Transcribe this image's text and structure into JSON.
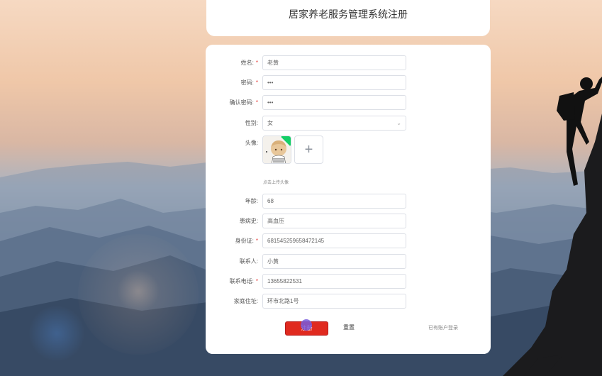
{
  "header": {
    "title": "居家养老服务管理系统注册"
  },
  "form": {
    "fields": [
      {
        "label": "姓名:",
        "required": true,
        "value": "老黄"
      },
      {
        "label": "密码:",
        "required": true,
        "value": "•••"
      },
      {
        "label": "确认密码:",
        "required": true,
        "value": "•••"
      },
      {
        "label": "性别:",
        "required": false,
        "value": "女"
      },
      {
        "label": "头像:",
        "required": false,
        "value": ""
      },
      {
        "label": "年龄:",
        "required": false,
        "value": "68"
      },
      {
        "label": "患病史:",
        "required": false,
        "value": "高血压"
      },
      {
        "label": "身份证:",
        "required": true,
        "value": "681545259658472145"
      },
      {
        "label": "联系人:",
        "required": false,
        "value": "小黄"
      },
      {
        "label": "联系电话:",
        "required": true,
        "value": "13655822531"
      },
      {
        "label": "家庭住址:",
        "required": false,
        "value": "环市北路1号"
      }
    ],
    "required_mark": "*",
    "upload_plus": "+",
    "upload_hint": "点击上传头像",
    "select_chevron": "⌄"
  },
  "actions": {
    "register_label": "注册",
    "reset_label": "重置",
    "login_link": "已有账户登录"
  },
  "colors": {
    "primary": "#e02a1f",
    "required": "#e53935",
    "upload_success": "#13ce66"
  }
}
